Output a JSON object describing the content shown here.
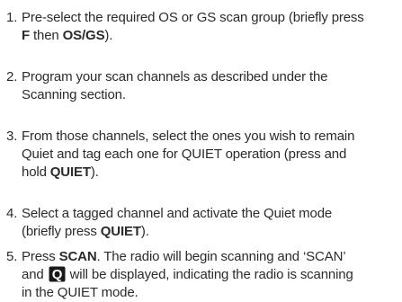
{
  "steps": [
    {
      "number": "1.",
      "lines": [
        [
          "Pre-select the required OS or GS scan group (briefly press"
        ],
        [
          {
            "b": "F"
          },
          " then ",
          {
            "b": "OS/GS"
          },
          ")."
        ]
      ]
    },
    {
      "number": "2.",
      "lines": [
        [
          "Program your scan channels as described under the"
        ],
        [
          "Scanning section."
        ]
      ]
    },
    {
      "number": "3.",
      "lines": [
        [
          "From those channels, select the ones you wish to remain"
        ],
        [
          "Quiet and tag each one for QUIET operation (press and"
        ],
        [
          "hold ",
          {
            "b": "QUIET"
          },
          ")."
        ]
      ]
    },
    {
      "number": "4.",
      "lines": [
        [
          "Select a tagged channel and activate the Quiet mode"
        ],
        [
          "(briefly press ",
          {
            "b": "QUIET"
          },
          ")."
        ]
      ]
    },
    {
      "number": "5.",
      "lines": [
        [
          "Press ",
          {
            "b": "SCAN"
          },
          ". The radio will begin scanning and ‘SCAN’"
        ],
        [
          "and ",
          {
            "icon": "quiet-mode-icon",
            "letter": "Q"
          },
          " will be displayed, indicating the radio is scanning"
        ],
        [
          "in the QUIET mode."
        ]
      ]
    }
  ],
  "colors": {
    "text": "#2b2b2b",
    "icon_background": "#1a1a1a",
    "icon_letter": "#ffffff"
  }
}
